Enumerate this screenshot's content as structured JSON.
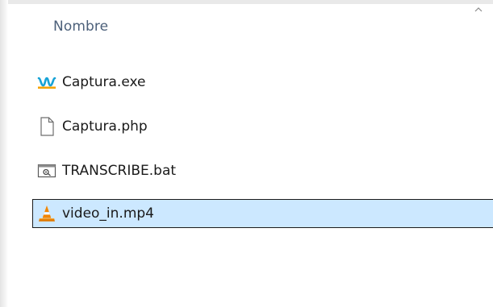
{
  "list": {
    "column_header": "Nombre",
    "items": [
      {
        "name": "Captura.exe",
        "icon": "app-waveform-icon",
        "selected": false
      },
      {
        "name": "Captura.php",
        "icon": "generic-file-icon",
        "selected": false
      },
      {
        "name": "TRANSCRIBE.bat",
        "icon": "batch-file-icon",
        "selected": false
      },
      {
        "name": "video_in.mp4",
        "icon": "vlc-cone-icon",
        "selected": true
      }
    ]
  },
  "colors": {
    "header_text": "#4c607a",
    "selection_bg": "#cce8ff",
    "selection_border": "#1b1b1b",
    "exe_icon": "#18a3d6",
    "vlc_orange": "#f28500"
  }
}
